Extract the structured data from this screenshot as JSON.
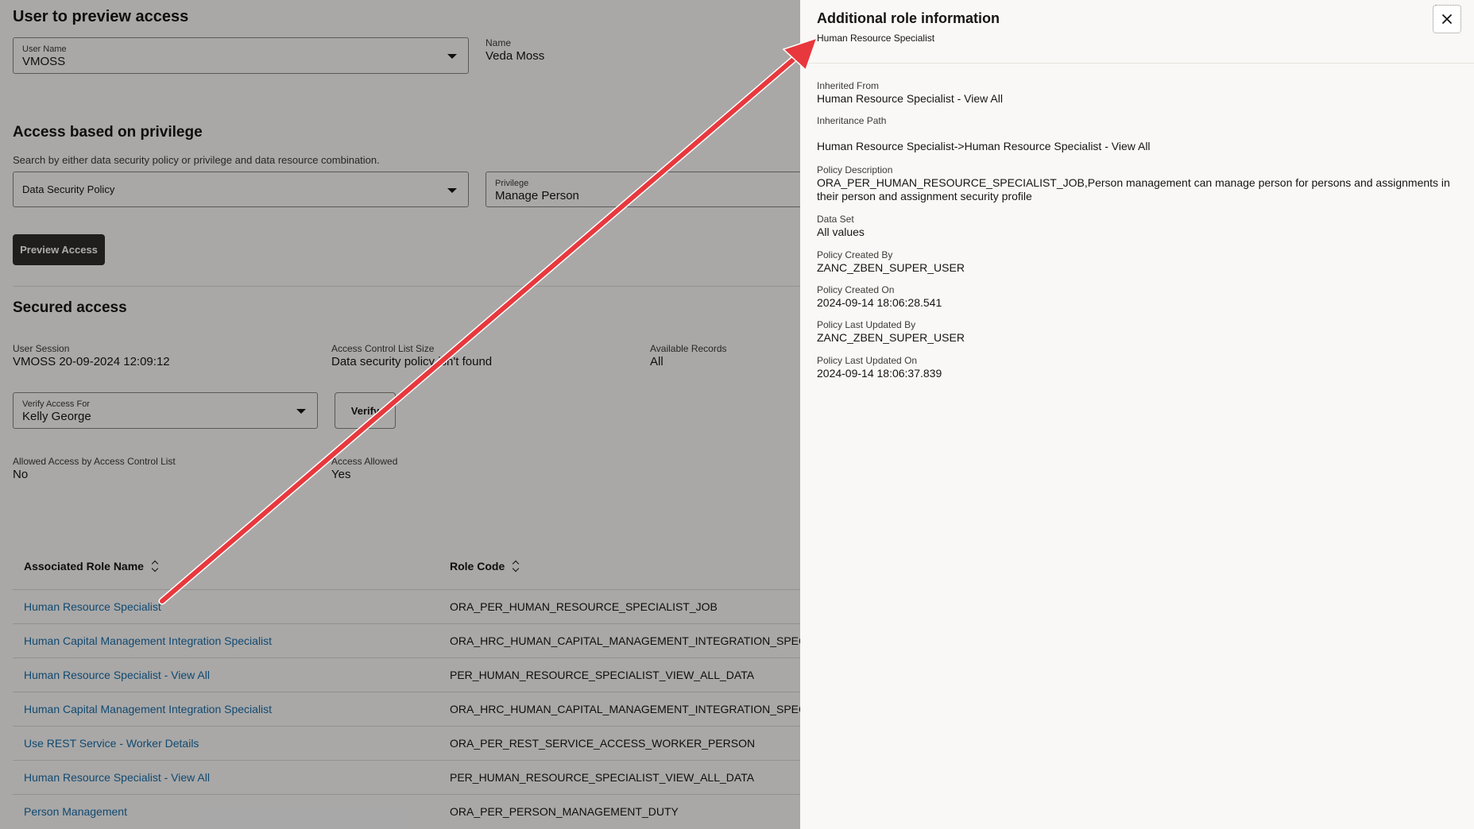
{
  "main": {
    "preview_title": "User to preview access",
    "user_name": {
      "label": "User Name",
      "value": "VMOSS"
    },
    "name": {
      "label": "Name",
      "value": "Veda Moss"
    },
    "privilege_section": {
      "title": "Access based on privilege",
      "helper": "Search by either data security policy or privilege and data resource combination.",
      "search_type": "Data Security Policy",
      "privilege": {
        "label": "Privilege",
        "value": "Manage Person"
      },
      "preview_button": "Preview Access"
    },
    "secured": {
      "title": "Secured access",
      "user_session": {
        "label": "User Session",
        "value": "VMOSS 20-09-2024 12:09:12"
      },
      "acl_size": {
        "label": "Access Control List Size",
        "value": "Data security policy isn't found"
      },
      "available_records": {
        "label": "Available Records",
        "value": "All"
      },
      "verify_for": {
        "label": "Verify Access For",
        "value": "Kelly George"
      },
      "verify_button": "Verify",
      "allowed_acl": {
        "label": "Allowed Access by Access Control List",
        "value": "No"
      },
      "access_allowed": {
        "label": "Access Allowed",
        "value": "Yes"
      }
    },
    "table": {
      "columns": [
        "Associated Role Name",
        "Role Code"
      ],
      "rows": [
        {
          "name": "Human Resource Specialist",
          "code": "ORA_PER_HUMAN_RESOURCE_SPECIALIST_JOB"
        },
        {
          "name": "Human Capital Management Integration Specialist",
          "code": "ORA_HRC_HUMAN_CAPITAL_MANAGEMENT_INTEGRATION_SPECIA"
        },
        {
          "name": "Human Resource Specialist - View All",
          "code": "PER_HUMAN_RESOURCE_SPECIALIST_VIEW_ALL_DATA"
        },
        {
          "name": "Human Capital Management Integration Specialist",
          "code": "ORA_HRC_HUMAN_CAPITAL_MANAGEMENT_INTEGRATION_SPECIA"
        },
        {
          "name": "Use REST Service - Worker Details",
          "code": "ORA_PER_REST_SERVICE_ACCESS_WORKER_PERSON"
        },
        {
          "name": "Human Resource Specialist - View All",
          "code": "PER_HUMAN_RESOURCE_SPECIALIST_VIEW_ALL_DATA"
        },
        {
          "name": "Person Management",
          "code": "ORA_PER_PERSON_MANAGEMENT_DUTY"
        }
      ]
    }
  },
  "drawer": {
    "title": "Additional role information",
    "subtitle": "Human Resource Specialist",
    "close_icon": "close-icon",
    "fields": {
      "inherited_from": {
        "label": "Inherited From",
        "value": "Human Resource Specialist - View All"
      },
      "inheritance_path": {
        "label": "Inheritance Path",
        "value": "Human Resource Specialist->Human Resource Specialist - View All"
      },
      "policy_description": {
        "label": "Policy Description",
        "value": "ORA_PER_HUMAN_RESOURCE_SPECIALIST_JOB,Person management can manage person for persons and assignments in their person and assignment security profile"
      },
      "data_set": {
        "label": "Data Set",
        "value": "All values"
      },
      "created_by": {
        "label": "Policy Created By",
        "value": "ZANC_ZBEN_SUPER_USER"
      },
      "created_on": {
        "label": "Policy Created On",
        "value": "2024-09-14 18:06:28.541"
      },
      "updated_by": {
        "label": "Policy Last Updated By",
        "value": "ZANC_ZBEN_SUPER_USER"
      },
      "updated_on": {
        "label": "Policy Last Updated On",
        "value": "2024-09-14 18:06:37.839"
      }
    }
  },
  "colors": {
    "arrow": "#e8383d",
    "link": "#1a6ea8",
    "dark_button": "#312d2a"
  }
}
